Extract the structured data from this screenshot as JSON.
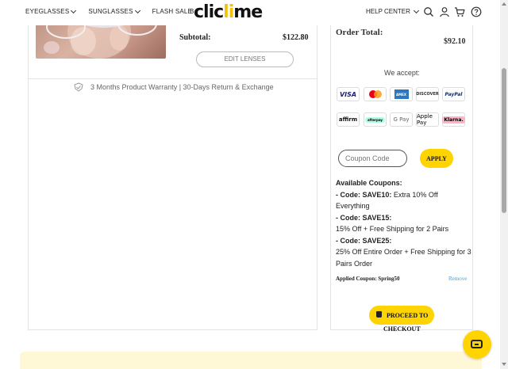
{
  "header": {
    "nav_left": [
      "EYEGLASSES",
      "SUNGLASSES",
      "FLASH SALE"
    ],
    "nav_partial": "B",
    "logo": {
      "part1": "clic",
      "part2": "li",
      "part3": "me"
    },
    "help_center": "HELP CENTER",
    "icons": [
      "search-icon",
      "user-icon",
      "cart-icon",
      "help-icon"
    ]
  },
  "product": {
    "subtotal_label": "Subtotal:",
    "subtotal_value": "$122.80",
    "edit_lenses_label": "EDIT LENSES",
    "warranty_text": "3 Months Product Warranty | 30-Days Return & Exchange"
  },
  "summary": {
    "order_total_label": "Order Total:",
    "order_total_value": "$92.10",
    "we_accept": "We accept:",
    "payment_methods": [
      "VISA",
      "Mastercard",
      "AMEX",
      "DISCOVER",
      "PayPal",
      "affirm",
      "afterpay",
      "G Pay",
      "Apple Pay",
      "Klarna."
    ],
    "coupon_placeholder": "Coupon Code",
    "apply_label": "APPLY",
    "available_title": "Available Coupons:",
    "coupons": [
      {
        "code": " - Code: SAVE10:",
        "desc": " Extra 10% Off Everything"
      },
      {
        "code": " - Code: SAVE15:",
        "desc": "15% Off + Free Shipping for 2 Pairs"
      },
      {
        "code": " - Code: SAVE25:",
        "desc": "25% Off Entire Order + Free Shipping for 3 Pairs Order"
      }
    ],
    "applied_coupon": "Applied Coupon: Spring50",
    "remove_label": "Remove",
    "proceed_line1": "PROCEED TO",
    "proceed_line2": "CHECKOUT"
  },
  "colors": {
    "accent": "#ffd400",
    "banner": "#fff8d6",
    "link": "#4a9fd8"
  }
}
